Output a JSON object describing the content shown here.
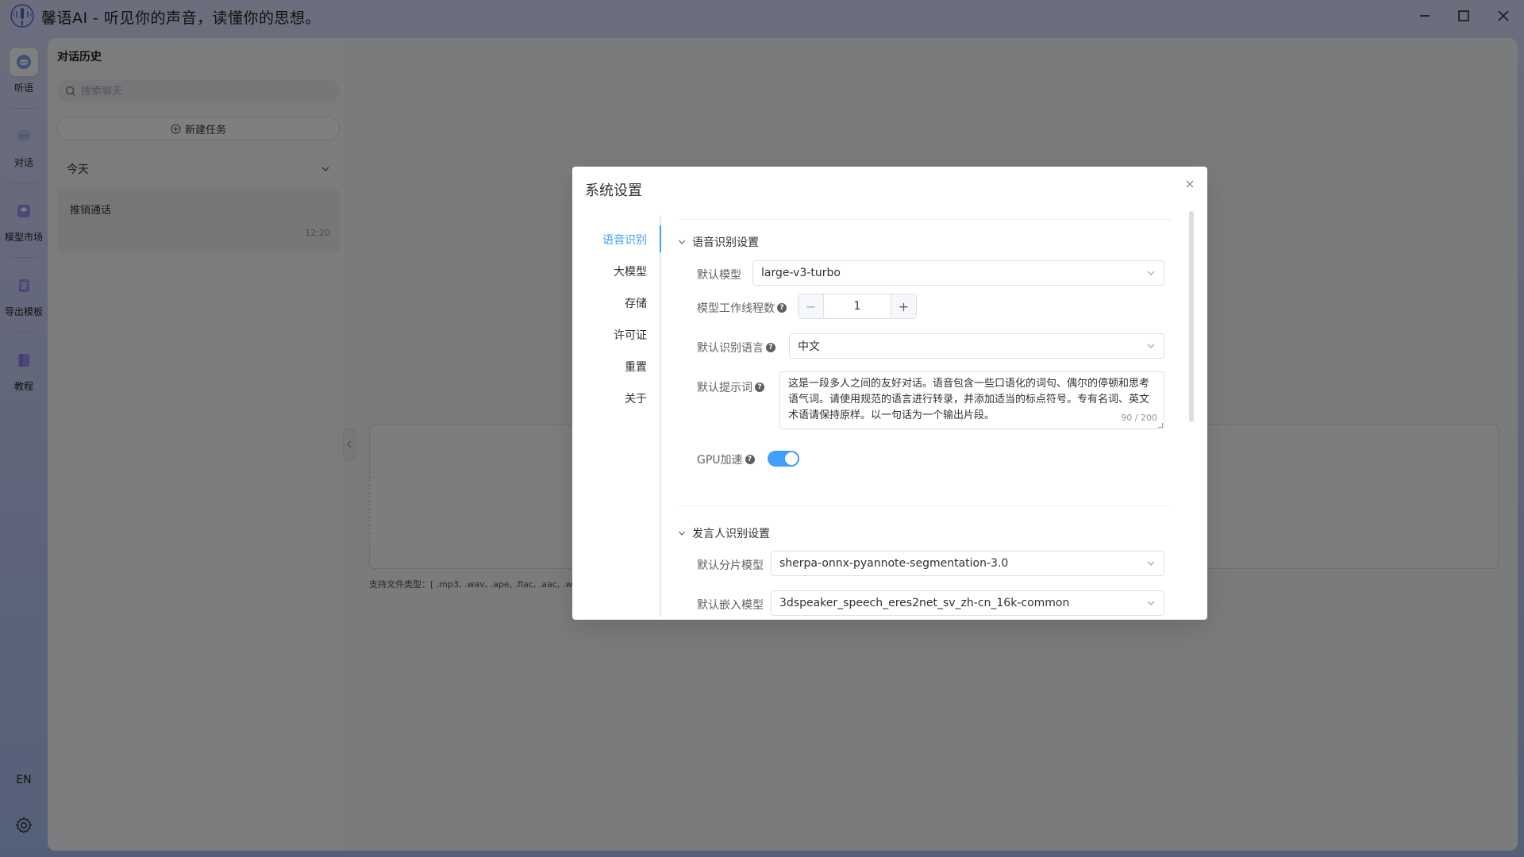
{
  "app": {
    "title": "馨语AI - 听见你的声音，读懂你的思想。"
  },
  "rail": {
    "items": [
      {
        "label": "听语",
        "icon": "robot-icon",
        "active": true
      },
      {
        "label": "对话",
        "icon": "chat-icon"
      },
      {
        "label": "模型市场",
        "icon": "cube-icon"
      },
      {
        "label": "导出模板",
        "icon": "document-icon"
      },
      {
        "label": "教程",
        "icon": "book-icon"
      }
    ],
    "lang": "EN"
  },
  "history": {
    "title": "对话历史",
    "search_placeholder": "搜索聊天",
    "new_task": "新建任务",
    "group": "今天",
    "items": [
      {
        "title": "推销通话",
        "time": "12:20"
      }
    ]
  },
  "main": {
    "file_types": "支持文件类型：[ .mp3, .wav, .ape, .flac, .aac, .w"
  },
  "dialog": {
    "title": "系统设置",
    "nav": [
      "语音识别",
      "大模型",
      "存储",
      "许可证",
      "重置",
      "关于"
    ],
    "asr_section": {
      "title": "语音识别设置",
      "default_model_label": "默认模型",
      "default_model_value": "large-v3-turbo",
      "threads_label": "模型工作线程数",
      "threads_value": "1",
      "lang_label": "默认识别语言",
      "lang_value": "中文",
      "prompt_label": "默认提示词",
      "prompt_value": "这是一段多人之间的友好对话。语音包含一些口语化的词句、偶尔的停顿和思考语气词。请使用规范的语言进行转录，并添加适当的标点符号。专有名词、英文术语请保持原样。以一句话为一个输出片段。",
      "prompt_count": "90 / 200",
      "gpu_label": "GPU加速",
      "gpu_enabled": true
    },
    "speaker_section": {
      "title": "发言人识别设置",
      "seg_label": "默认分片模型",
      "seg_value": "sherpa-onnx-pyannote-segmentation-3.0",
      "embed_label": "默认嵌入模型",
      "embed_value": "3dspeaker_speech_eres2net_sv_zh-cn_16k-common"
    }
  },
  "colors": {
    "accent": "#409eff",
    "overlay": "rgba(0,0,0,0.5)"
  }
}
